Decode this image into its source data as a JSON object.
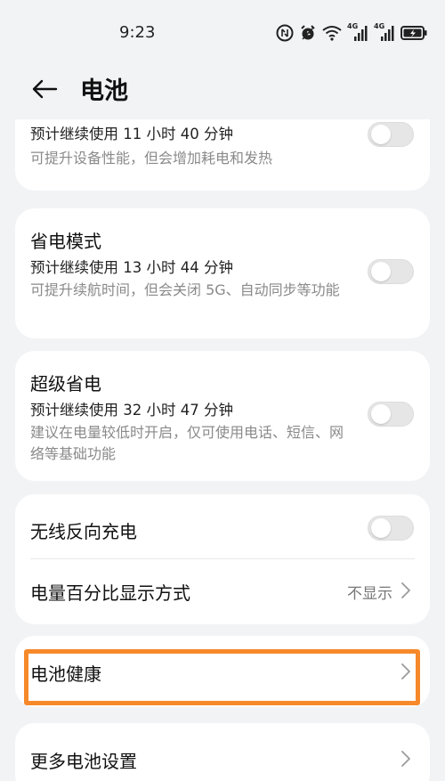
{
  "status": {
    "time": "9:23",
    "network_labels": [
      "4G",
      "4G"
    ],
    "icons": [
      "data-icon",
      "alarm-icon",
      "wifi-icon",
      "signal-icon",
      "signal-icon",
      "battery-icon"
    ]
  },
  "header": {
    "title": "电池",
    "back_icon": "arrow-left-icon"
  },
  "performance": {
    "estimate": "预计继续使用 11 小时 40 分钟",
    "desc": "可提升设备性能，但会增加耗电和发热",
    "enabled": false
  },
  "power_saving": {
    "title": "省电模式",
    "estimate": "预计继续使用 13 小时 44 分钟",
    "desc": "可提升续航时间，但会关闭 5G、自动同步等功能",
    "enabled": false
  },
  "super_saving": {
    "title": "超级省电",
    "estimate": "预计继续使用 32 小时 47 分钟",
    "desc": "建议在电量较低时开启，仅可使用电话、短信、网络等基础功能",
    "enabled": false
  },
  "wireless_reverse": {
    "title": "无线反向充电",
    "enabled": false
  },
  "percentage_display": {
    "title": "电量百分比显示方式",
    "value": "不显示"
  },
  "battery_health": {
    "title": "电池健康"
  },
  "more_settings": {
    "title": "更多电池设置"
  },
  "colors": {
    "highlight": "#f6892a",
    "background": "#f1f3f5",
    "card": "#ffffff"
  }
}
